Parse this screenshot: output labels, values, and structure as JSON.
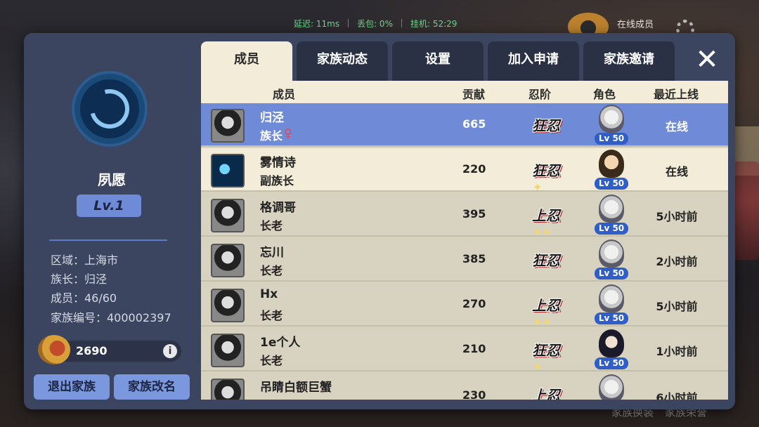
{
  "hud": {
    "latency": "延迟: 11ms",
    "packet_loss": "丢包: 0%",
    "idle": "挂机: 52:29"
  },
  "top_right": {
    "online_label": "在线成员"
  },
  "bottom_links": [
    "家族换装",
    "家族荣誉"
  ],
  "family": {
    "name": "夙愿",
    "level": "Lv.1",
    "region": "区域：上海市",
    "leader": "族长：归泾",
    "members": "成员：46/60",
    "id": "家族编号：400002397",
    "currency": "2690"
  },
  "buttons": {
    "quit": "退出家族",
    "rename": "家族改名",
    "close": "✕"
  },
  "tabs": [
    "成员",
    "家族动态",
    "设置",
    "加入申请",
    "家族邀请"
  ],
  "columns": {
    "member": "成员",
    "contribution": "贡献",
    "rank": "忍阶",
    "role_char": "角色",
    "last_online": "最近上线"
  },
  "rows": [
    {
      "name": "归泾",
      "role": "族长",
      "female": "♀",
      "contribution": "665",
      "rank": "狂忍",
      "star": "",
      "lv": "Lv 50",
      "last": "在线"
    },
    {
      "name": "雾情诗",
      "role": "副族长",
      "female": "",
      "contribution": "220",
      "rank": "狂忍",
      "star": "✦",
      "lv": "Lv 50",
      "last": "在线"
    },
    {
      "name": "格调哥",
      "role": "长老",
      "female": "",
      "contribution": "395",
      "rank": "上忍",
      "star": "✦✦",
      "lv": "Lv 50",
      "last": "5小时前"
    },
    {
      "name": "忘川",
      "role": "长老",
      "female": "",
      "contribution": "385",
      "rank": "狂忍",
      "star": "",
      "lv": "Lv 50",
      "last": "2小时前"
    },
    {
      "name": "Hx",
      "role": "长老",
      "female": "",
      "contribution": "270",
      "rank": "上忍",
      "star": "✦✦",
      "lv": "Lv 50",
      "last": "5小时前"
    },
    {
      "name": "1e个人",
      "role": "长老",
      "female": "",
      "contribution": "210",
      "rank": "狂忍",
      "star": "✦",
      "lv": "Lv 50",
      "last": "1小时前"
    },
    {
      "name": "吊睛白额巨蟹",
      "role": "",
      "female": "",
      "contribution": "230",
      "rank": "上忍",
      "star": "",
      "lv": "",
      "last": "6小时前"
    }
  ]
}
